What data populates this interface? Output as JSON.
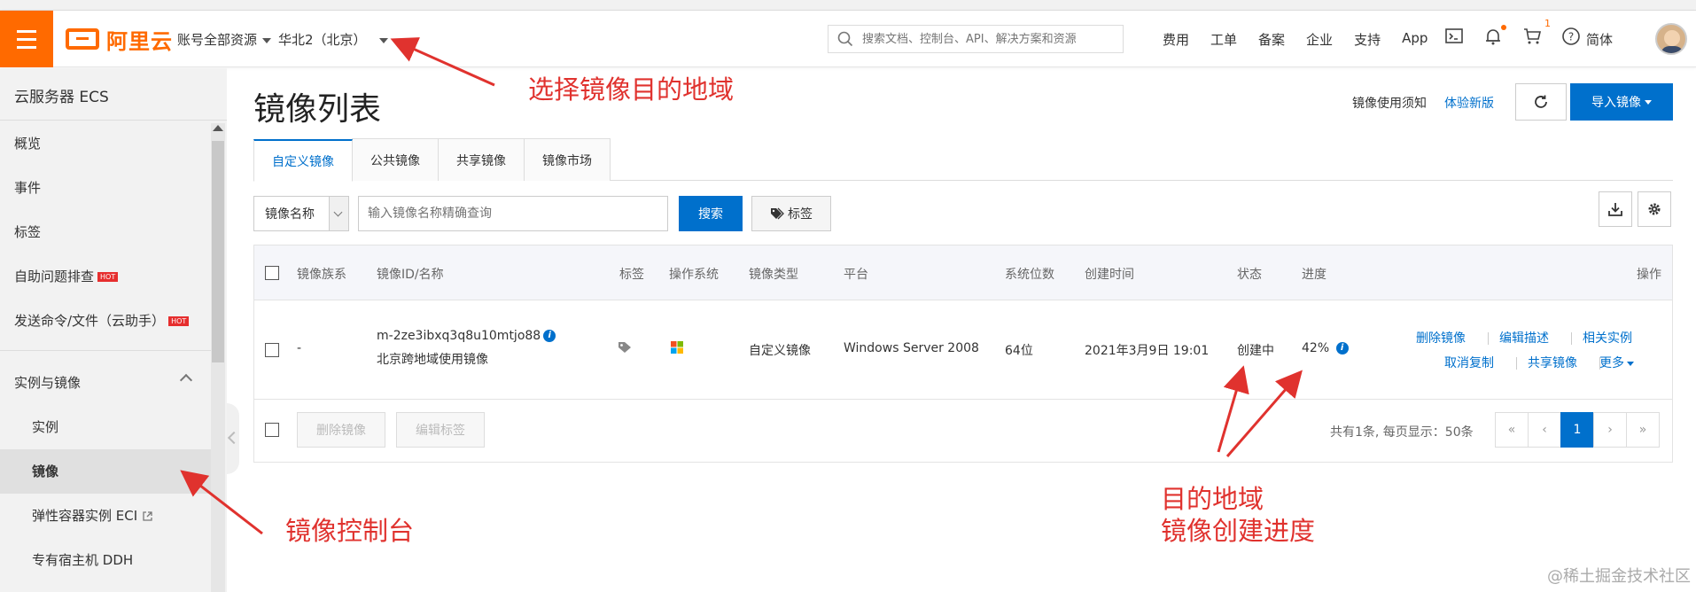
{
  "header": {
    "logo_text": "阿里云",
    "resource_select": "账号全部资源",
    "region_select": "华北2（北京）",
    "search_placeholder": "搜索文档、控制台、API、解决方案和资源",
    "nav": [
      "费用",
      "工单",
      "备案",
      "企业",
      "支持",
      "App"
    ],
    "cart_count": "1",
    "language": "简体",
    "accent_color": "#ff6a00"
  },
  "sidebar": {
    "title": "云服务器 ECS",
    "items": [
      {
        "label": "概览"
      },
      {
        "label": "事件"
      },
      {
        "label": "标签"
      },
      {
        "label": "自助问题排查",
        "badge": "HOT"
      },
      {
        "label": "发送命令/文件（云助手）",
        "badge": "HOT"
      }
    ],
    "group": {
      "label": "实例与镜像",
      "items": [
        {
          "label": "实例"
        },
        {
          "label": "镜像"
        },
        {
          "label": "弹性容器实例 ECI"
        },
        {
          "label": "专有宿主机 DDH"
        }
      ]
    }
  },
  "main": {
    "title": "镜像列表",
    "links": {
      "notice": "镜像使用须知",
      "new_version": "体验新版"
    },
    "import_button": "导入镜像",
    "tabs": [
      "自定义镜像",
      "公共镜像",
      "共享镜像",
      "镜像市场"
    ],
    "filter": {
      "select": "镜像名称",
      "placeholder": "输入镜像名称精确查询",
      "search_button": "搜索",
      "tag_button": "标签"
    },
    "table": {
      "headers": [
        "镜像族系",
        "镜像ID/名称",
        "标签",
        "操作系统",
        "镜像类型",
        "平台",
        "系统位数",
        "创建时间",
        "状态",
        "进度",
        "操作"
      ],
      "row": {
        "family": "-",
        "image_id": "m-2ze3ibxq3q8u10mtjo88",
        "image_name": "北京跨地域使用镜像",
        "image_type": "自定义镜像",
        "platform": "Windows Server 2008",
        "bits": "64位",
        "created": "2021年3月9日 19:01",
        "status": "创建中",
        "progress": "42%",
        "actions": [
          "删除镜像",
          "编辑描述",
          "相关实例",
          "取消复制",
          "共享镜像",
          "更多"
        ]
      },
      "footer": {
        "delete_button": "删除镜像",
        "edit_tag_button": "编辑标签",
        "summary": "共有1条, 每页显示：50条",
        "pages": [
          "«",
          "‹",
          "1",
          "›",
          "»"
        ]
      }
    },
    "primary_color": "#0070cc"
  },
  "annotations": {
    "select_region": "选择镜像目的地域",
    "image_console": "镜像控制台",
    "target_region": "目的地域",
    "progress": "镜像创建进度",
    "color": "#e0322e"
  },
  "watermark": "@稀土掘金技术社区"
}
